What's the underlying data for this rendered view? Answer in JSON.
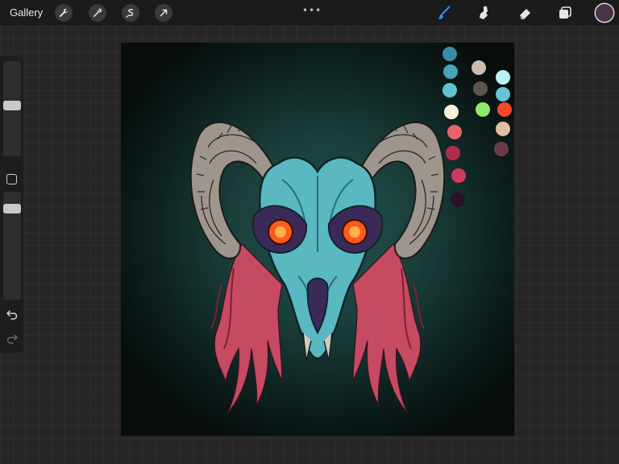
{
  "topbar": {
    "gallery_label": "Gallery",
    "more_label": "•••",
    "tools": [
      "wrench-icon",
      "magic-wand-icon",
      "selection-icon",
      "transform-arrow-icon"
    ],
    "right_tools": [
      "brush-icon",
      "smudge-icon",
      "eraser-icon",
      "layers-icon"
    ],
    "active_tool": "brush",
    "current_color": "#4c3347"
  },
  "sidebar": {
    "brush_size_level": 0.35,
    "opacity_level": 0.2
  },
  "palette": {
    "colors": [
      "#3b8aa6",
      "#4aa3b8",
      "#5fc4cf",
      "#f6f1d6",
      "#e8646d",
      "#b22d4d",
      "#cf3a5e",
      "#2a1029",
      "#cdbcae",
      "#5e564e",
      "#8ee86a",
      "#bdf0f6",
      "#68c3d6",
      "#ef4a2b",
      "#e2bea0",
      "#6a3a46"
    ]
  },
  "artwork": {
    "subject": "ram-skull-illustration",
    "background_color": "#1a3f3b",
    "skull_color": "#59b8c0",
    "horn_color": "#9e968d",
    "hair_color": "#c64a60",
    "eye_color": "#ff5a1e"
  }
}
